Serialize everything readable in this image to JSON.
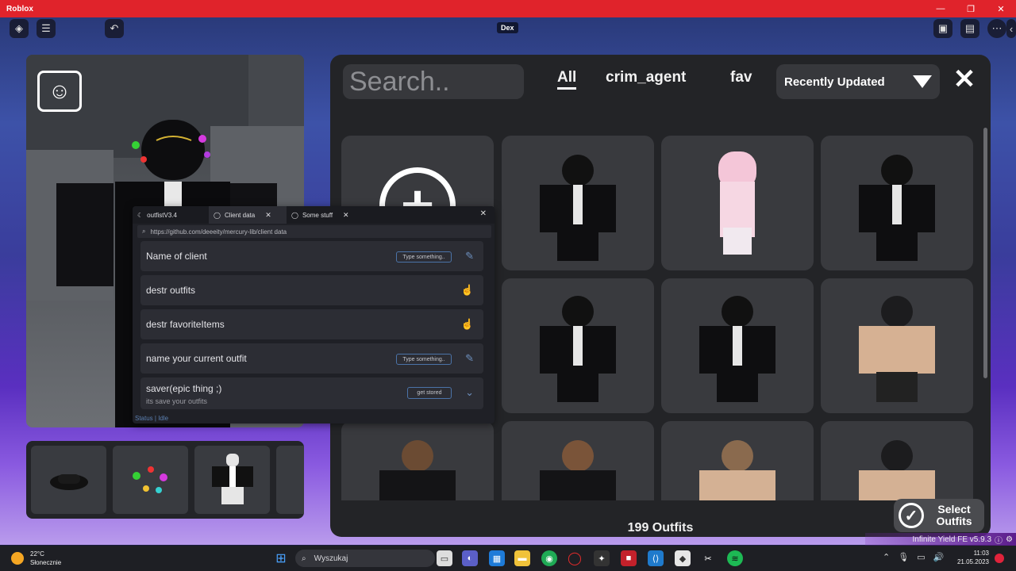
{
  "window": {
    "title": "Roblox",
    "controls": [
      "—",
      "❐",
      "✕"
    ]
  },
  "game_topbar": {
    "dex_label": "Dex"
  },
  "outfits_panel": {
    "search_placeholder": "Search..",
    "tabs": [
      {
        "label": "All",
        "active": true
      },
      {
        "label": "crim_agent",
        "active": false
      },
      {
        "label": "fav",
        "active": false
      }
    ],
    "sort_label": "Recently Updated",
    "count_label": "199 Outfits",
    "select_label_line1": "Select",
    "select_label_line2": "Outfits"
  },
  "mercury": {
    "tabs": [
      {
        "label": "outfistV3.4",
        "icon": "moon-icon"
      },
      {
        "label": "Client data",
        "icon": "circle-icon",
        "closable": true
      },
      {
        "label": "Some stuff",
        "icon": "circle-icon",
        "closable": true
      }
    ],
    "url": "https://github.com/deeeity/mercury-lib/client data",
    "rows": [
      {
        "label": "Name of client",
        "control": "input",
        "control_text": "Type something..",
        "icon": "pencil-icon"
      },
      {
        "label": "destr outfits",
        "control": "none",
        "icon": "pointer-icon"
      },
      {
        "label": "destr favoriteItems",
        "control": "none",
        "icon": "pointer-icon"
      },
      {
        "label": "name your current outfit",
        "control": "input",
        "control_text": "Type something..",
        "icon": "pencil-icon"
      },
      {
        "label": "saver(epic thing ;)",
        "sublabel": "its save your outfits",
        "control": "button",
        "control_text": "get stored",
        "icon": "chevron-down-icon"
      }
    ],
    "status": "Status | Idle"
  },
  "watermark": {
    "text": "Infinite Yield FE v5.9.3"
  },
  "taskbar": {
    "weather_temp": "22°C",
    "weather_desc": "Słonecznie",
    "search_label": "Wyszukaj",
    "time": "11:03",
    "date": "21.05.2023"
  }
}
